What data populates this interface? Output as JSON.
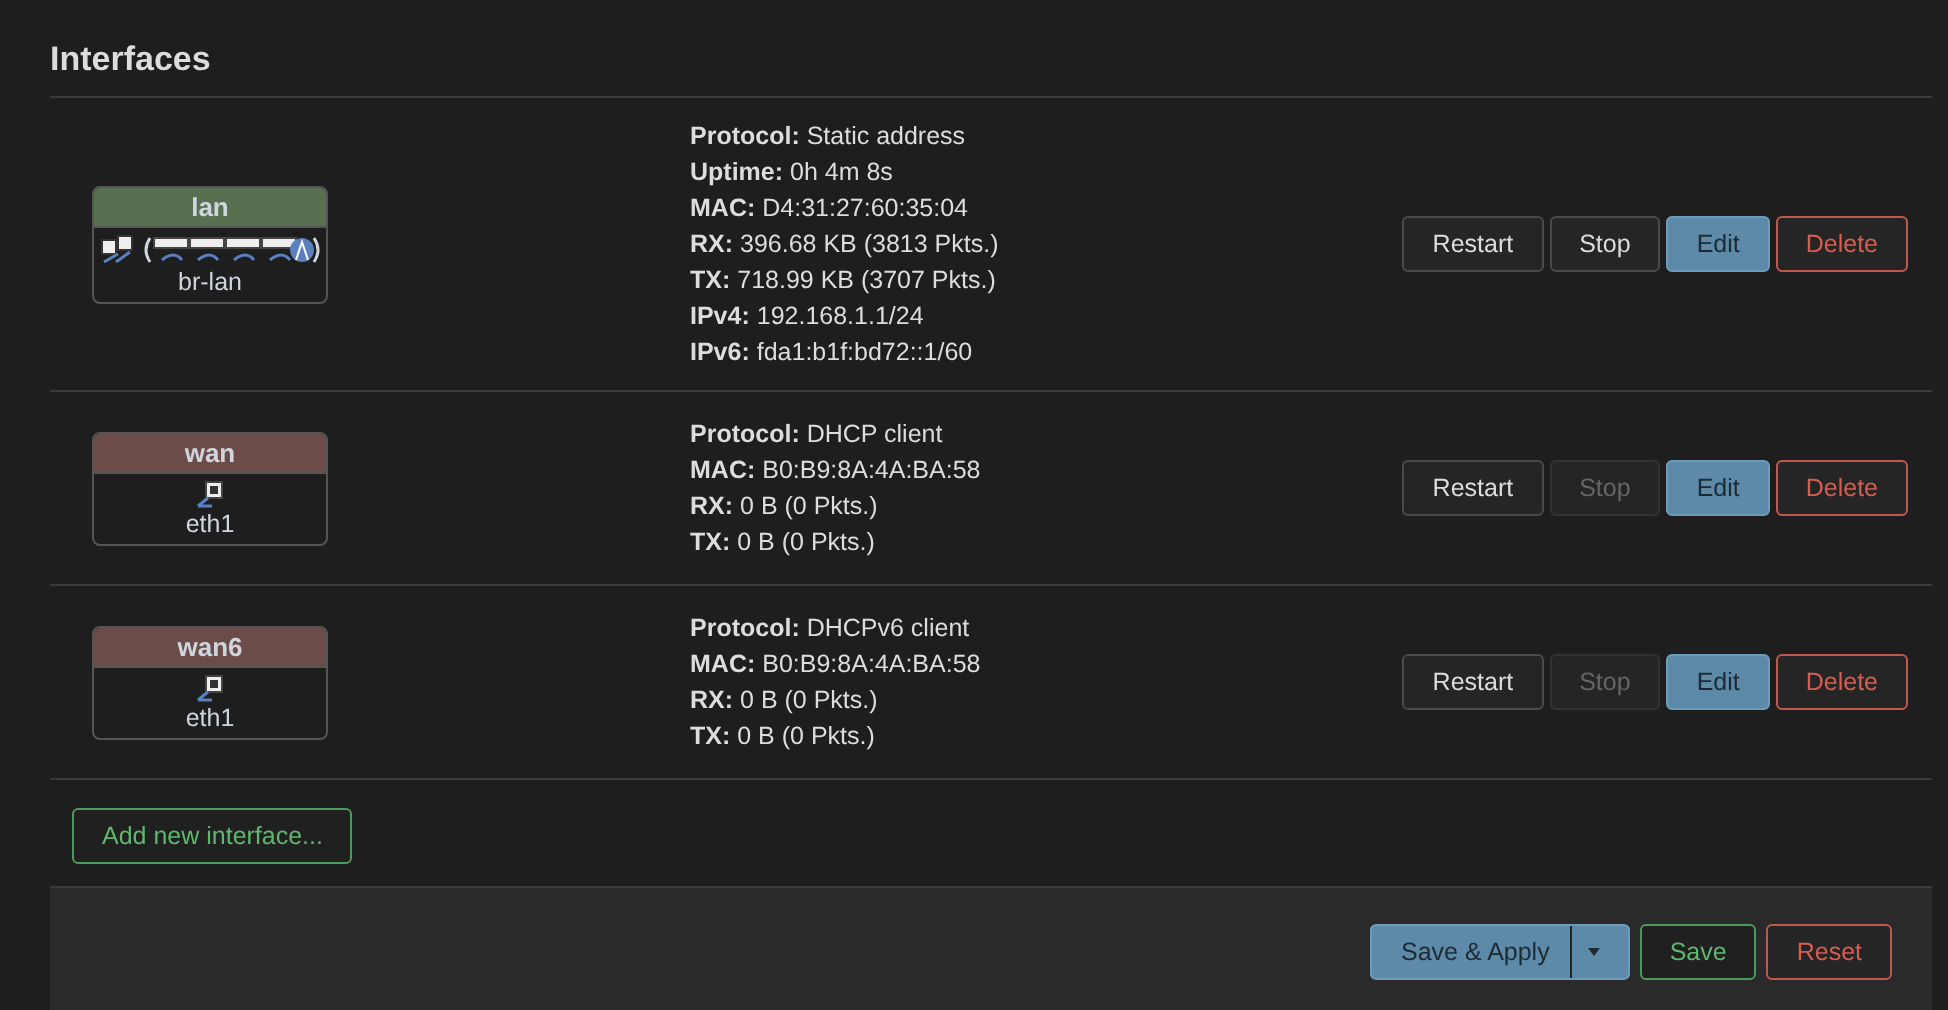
{
  "section": {
    "title": "Interfaces"
  },
  "interfaces": [
    {
      "name": "lan",
      "color": "#58704f",
      "device": "br-lan",
      "kind": "bridge",
      "details": [
        {
          "label": "Protocol:",
          "value": "Static address"
        },
        {
          "label": "Uptime:",
          "value": "0h 4m 8s"
        },
        {
          "label": "MAC:",
          "value": "D4:31:27:60:35:04"
        },
        {
          "label": "RX:",
          "value": "396.68 KB (3813 Pkts.)"
        },
        {
          "label": "TX:",
          "value": "718.99 KB (3707 Pkts.)"
        },
        {
          "label": "IPv4:",
          "value": "192.168.1.1/24"
        },
        {
          "label": "IPv6:",
          "value": "fda1:b1f:bd72::1/60"
        }
      ],
      "buttons": [
        {
          "label": "Restart",
          "kind": "neutral",
          "disabled": false
        },
        {
          "label": "Stop",
          "kind": "neutral",
          "disabled": false
        },
        {
          "label": "Edit",
          "kind": "primary",
          "disabled": false
        },
        {
          "label": "Delete",
          "kind": "danger",
          "disabled": false
        }
      ]
    },
    {
      "name": "wan",
      "color": "#6b4c48",
      "device": "eth1",
      "kind": "ethernet",
      "details": [
        {
          "label": "Protocol:",
          "value": "DHCP client"
        },
        {
          "label": "MAC:",
          "value": "B0:B9:8A:4A:BA:58"
        },
        {
          "label": "RX:",
          "value": "0 B (0 Pkts.)"
        },
        {
          "label": "TX:",
          "value": "0 B (0 Pkts.)"
        }
      ],
      "buttons": [
        {
          "label": "Restart",
          "kind": "neutral",
          "disabled": false
        },
        {
          "label": "Stop",
          "kind": "neutral",
          "disabled": true
        },
        {
          "label": "Edit",
          "kind": "primary",
          "disabled": false
        },
        {
          "label": "Delete",
          "kind": "danger",
          "disabled": false
        }
      ]
    },
    {
      "name": "wan6",
      "color": "#6b4c48",
      "device": "eth1",
      "kind": "ethernet",
      "details": [
        {
          "label": "Protocol:",
          "value": "DHCPv6 client"
        },
        {
          "label": "MAC:",
          "value": "B0:B9:8A:4A:BA:58"
        },
        {
          "label": "RX:",
          "value": "0 B (0 Pkts.)"
        },
        {
          "label": "TX:",
          "value": "0 B (0 Pkts.)"
        }
      ],
      "buttons": [
        {
          "label": "Restart",
          "kind": "neutral",
          "disabled": false
        },
        {
          "label": "Stop",
          "kind": "neutral",
          "disabled": true
        },
        {
          "label": "Edit",
          "kind": "primary",
          "disabled": false
        },
        {
          "label": "Delete",
          "kind": "danger",
          "disabled": false
        }
      ]
    }
  ],
  "add_button": {
    "label": "Add new interface..."
  },
  "footer": {
    "buttons": [
      {
        "label": "Save & Apply",
        "kind": "primary",
        "dropdown": true
      },
      {
        "label": "Save",
        "kind": "positive",
        "dropdown": false
      },
      {
        "label": "Reset",
        "kind": "danger",
        "dropdown": false
      }
    ]
  }
}
